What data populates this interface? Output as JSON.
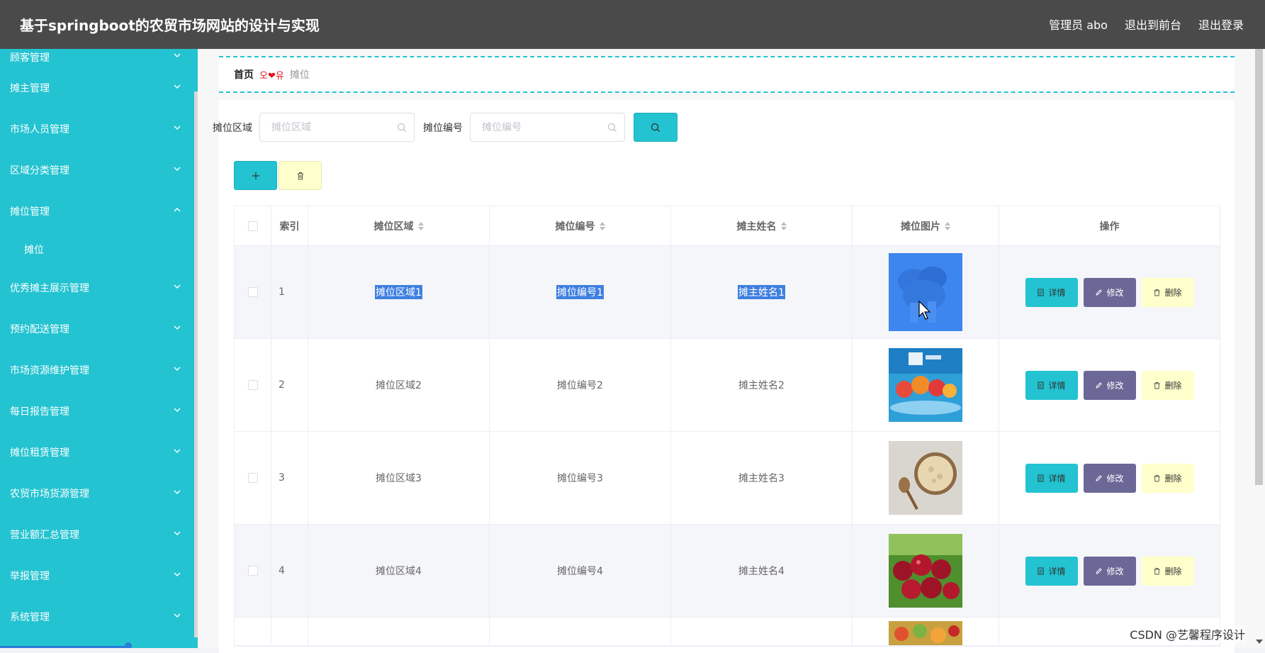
{
  "header": {
    "title": "基于springboot的农贸市场网站的设计与实现",
    "user": "管理员 abo",
    "to_front": "退出到前台",
    "logout": "退出登录"
  },
  "sidebar": {
    "items": [
      {
        "label": "顾客管理"
      },
      {
        "label": "摊主管理"
      },
      {
        "label": "市场人员管理"
      },
      {
        "label": "区域分类管理"
      },
      {
        "label": "摊位管理",
        "expanded": true,
        "children": [
          {
            "label": "摊位"
          }
        ]
      },
      {
        "label": "优秀摊主展示管理"
      },
      {
        "label": "预约配送管理"
      },
      {
        "label": "市场资源维护管理"
      },
      {
        "label": "每日报告管理"
      },
      {
        "label": "摊位租赁管理"
      },
      {
        "label": "农贸市场货源管理"
      },
      {
        "label": "营业额汇总管理"
      },
      {
        "label": "举报管理"
      },
      {
        "label": "系统管理"
      }
    ]
  },
  "breadcrumb": {
    "home": "首页",
    "separator": "오❤유",
    "current": "摊位"
  },
  "search": {
    "area_label": "摊位区域",
    "area_placeholder": "摊位区域",
    "code_label": "摊位编号",
    "code_placeholder": "摊位编号"
  },
  "table": {
    "columns": [
      "索引",
      "摊位区域",
      "摊位编号",
      "摊主姓名",
      "摊位图片",
      "操作"
    ],
    "rows": [
      {
        "index": "1",
        "area": "摊位区域1",
        "code": "摊位编号1",
        "owner": "摊主姓名1",
        "image": "vegetable-photo",
        "selected_text": true
      },
      {
        "index": "2",
        "area": "摊位区域2",
        "code": "摊位编号2",
        "owner": "摊主姓名2",
        "image": "fresh-fruit-poster"
      },
      {
        "index": "3",
        "area": "摊位区域3",
        "code": "摊位编号3",
        "owner": "摊主姓名3",
        "image": "oats-bowl-photo"
      },
      {
        "index": "4",
        "area": "摊位区域4",
        "code": "摊位编号4",
        "owner": "摊主姓名4",
        "image": "cherries-photo"
      }
    ],
    "ops": {
      "view": "详情",
      "edit": "修改",
      "delete": "删除"
    }
  },
  "watermark": "CSDN @艺馨程序设计",
  "colors": {
    "header_bg": "#4a4a4a",
    "sidebar_bg": "#23c3d1",
    "accent": "#23c3d1",
    "edit_btn": "#6b6797",
    "delete_btn": "#ffffcc",
    "text_selection": "#3f7fe0"
  }
}
